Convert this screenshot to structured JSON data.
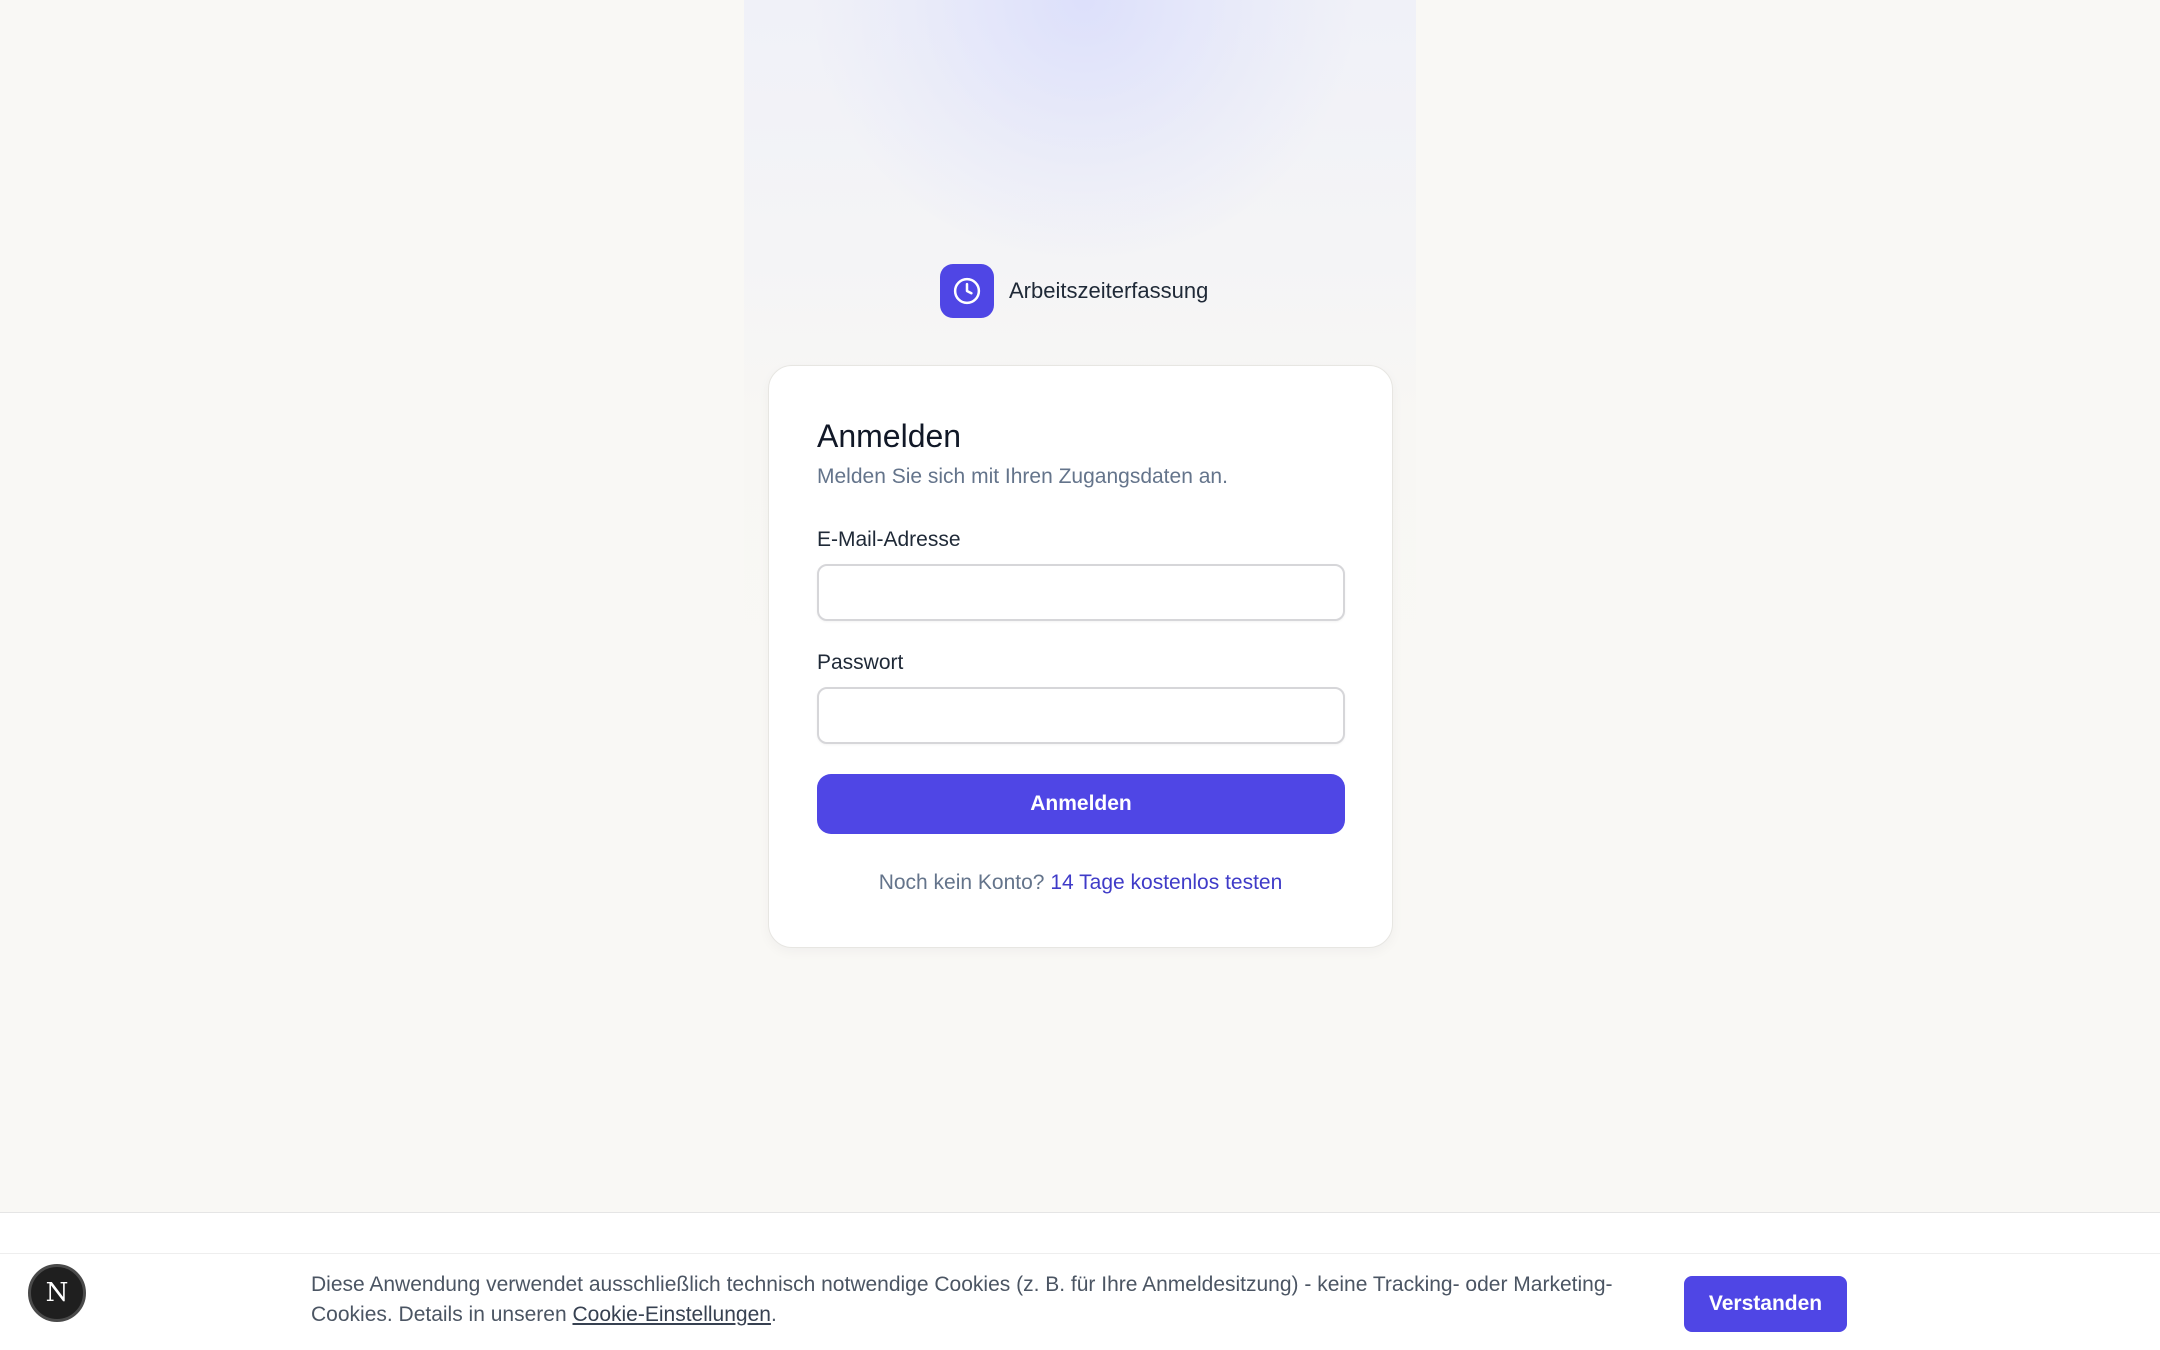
{
  "brand": {
    "name": "Arbeitszeiterfassung",
    "logo_icon": "clock-icon",
    "accent_color": "#4f46e5"
  },
  "login": {
    "title": "Anmelden",
    "subtitle": "Melden Sie sich mit Ihren Zugangsdaten an.",
    "email_label": "E-Mail-Adresse",
    "email_value": "",
    "password_label": "Passwort",
    "password_value": "",
    "submit_label": "Anmelden",
    "signup_prompt": "Noch kein Konto?",
    "signup_link": "14 Tage kostenlos testen"
  },
  "cookie_banner": {
    "text": "Diese Anwendung verwendet ausschließlich technisch notwendige Cookies (z. B. für Ihre Anmeldesitzung) - keine Tracking- oder Marketing-Cookies. Details in unseren",
    "link": "Cookie-Einstellungen",
    "suffix": ".",
    "button_label": "Verstanden"
  },
  "dev_badge": {
    "letter": "N"
  }
}
